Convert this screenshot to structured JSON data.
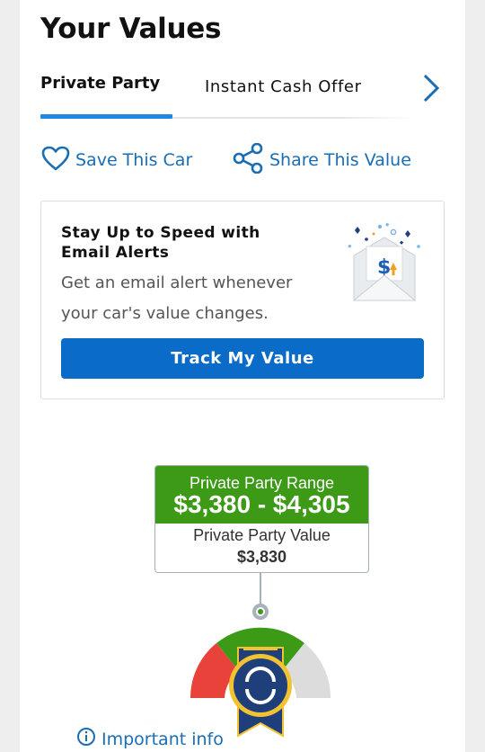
{
  "page": {
    "title": "Your Values"
  },
  "tabs": [
    {
      "label": "Private Party",
      "active": true
    },
    {
      "label": "Instant Cash Offer",
      "active": false
    }
  ],
  "actions": {
    "save_label": "Save This Car",
    "share_label": "Share This Value"
  },
  "alert": {
    "title": "Stay Up to Speed with Email Alerts",
    "body": "Get an email alert whenever your car's value changes.",
    "button_label": "Track My Value"
  },
  "valuation": {
    "range_label": "Private Party Range",
    "range_value": "$3,380 - $4,305",
    "value_label": "Private Party Value",
    "value": "$3,830"
  },
  "footer": {
    "info_label": "Important info"
  },
  "icons": {
    "heart": "heart-icon",
    "share": "share-icon",
    "next": "chevron-right-icon",
    "info": "info-icon",
    "mail": "email-dollar-illustration",
    "badge": "kbb-badge-icon"
  },
  "colors": {
    "accent_blue": "#1e88e5",
    "link_blue": "#1a6db3",
    "button_blue": "#0b6bc9",
    "range_green": "#3c9a16",
    "gauge_red": "#e8423a",
    "gauge_green": "#3c9a16",
    "gauge_gray": "#dcdcdc",
    "badge_navy": "#1e3f7a",
    "badge_gold": "#f2c230"
  }
}
